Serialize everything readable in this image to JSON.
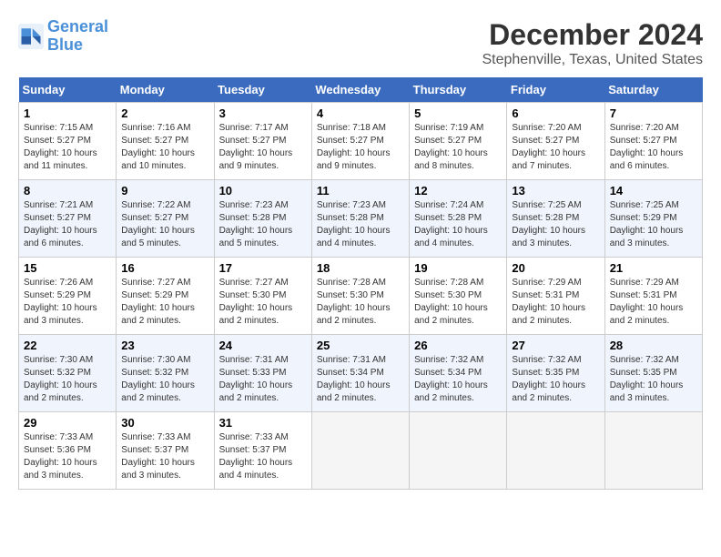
{
  "logo": {
    "line1": "General",
    "line2": "Blue"
  },
  "title": "December 2024",
  "subtitle": "Stephenville, Texas, United States",
  "days_of_week": [
    "Sunday",
    "Monday",
    "Tuesday",
    "Wednesday",
    "Thursday",
    "Friday",
    "Saturday"
  ],
  "weeks": [
    [
      {
        "day": "1",
        "info": "Sunrise: 7:15 AM\nSunset: 5:27 PM\nDaylight: 10 hours\nand 11 minutes."
      },
      {
        "day": "2",
        "info": "Sunrise: 7:16 AM\nSunset: 5:27 PM\nDaylight: 10 hours\nand 10 minutes."
      },
      {
        "day": "3",
        "info": "Sunrise: 7:17 AM\nSunset: 5:27 PM\nDaylight: 10 hours\nand 9 minutes."
      },
      {
        "day": "4",
        "info": "Sunrise: 7:18 AM\nSunset: 5:27 PM\nDaylight: 10 hours\nand 9 minutes."
      },
      {
        "day": "5",
        "info": "Sunrise: 7:19 AM\nSunset: 5:27 PM\nDaylight: 10 hours\nand 8 minutes."
      },
      {
        "day": "6",
        "info": "Sunrise: 7:20 AM\nSunset: 5:27 PM\nDaylight: 10 hours\nand 7 minutes."
      },
      {
        "day": "7",
        "info": "Sunrise: 7:20 AM\nSunset: 5:27 PM\nDaylight: 10 hours\nand 6 minutes."
      }
    ],
    [
      {
        "day": "8",
        "info": "Sunrise: 7:21 AM\nSunset: 5:27 PM\nDaylight: 10 hours\nand 6 minutes."
      },
      {
        "day": "9",
        "info": "Sunrise: 7:22 AM\nSunset: 5:27 PM\nDaylight: 10 hours\nand 5 minutes."
      },
      {
        "day": "10",
        "info": "Sunrise: 7:23 AM\nSunset: 5:28 PM\nDaylight: 10 hours\nand 5 minutes."
      },
      {
        "day": "11",
        "info": "Sunrise: 7:23 AM\nSunset: 5:28 PM\nDaylight: 10 hours\nand 4 minutes."
      },
      {
        "day": "12",
        "info": "Sunrise: 7:24 AM\nSunset: 5:28 PM\nDaylight: 10 hours\nand 4 minutes."
      },
      {
        "day": "13",
        "info": "Sunrise: 7:25 AM\nSunset: 5:28 PM\nDaylight: 10 hours\nand 3 minutes."
      },
      {
        "day": "14",
        "info": "Sunrise: 7:25 AM\nSunset: 5:29 PM\nDaylight: 10 hours\nand 3 minutes."
      }
    ],
    [
      {
        "day": "15",
        "info": "Sunrise: 7:26 AM\nSunset: 5:29 PM\nDaylight: 10 hours\nand 3 minutes."
      },
      {
        "day": "16",
        "info": "Sunrise: 7:27 AM\nSunset: 5:29 PM\nDaylight: 10 hours\nand 2 minutes."
      },
      {
        "day": "17",
        "info": "Sunrise: 7:27 AM\nSunset: 5:30 PM\nDaylight: 10 hours\nand 2 minutes."
      },
      {
        "day": "18",
        "info": "Sunrise: 7:28 AM\nSunset: 5:30 PM\nDaylight: 10 hours\nand 2 minutes."
      },
      {
        "day": "19",
        "info": "Sunrise: 7:28 AM\nSunset: 5:30 PM\nDaylight: 10 hours\nand 2 minutes."
      },
      {
        "day": "20",
        "info": "Sunrise: 7:29 AM\nSunset: 5:31 PM\nDaylight: 10 hours\nand 2 minutes."
      },
      {
        "day": "21",
        "info": "Sunrise: 7:29 AM\nSunset: 5:31 PM\nDaylight: 10 hours\nand 2 minutes."
      }
    ],
    [
      {
        "day": "22",
        "info": "Sunrise: 7:30 AM\nSunset: 5:32 PM\nDaylight: 10 hours\nand 2 minutes."
      },
      {
        "day": "23",
        "info": "Sunrise: 7:30 AM\nSunset: 5:32 PM\nDaylight: 10 hours\nand 2 minutes."
      },
      {
        "day": "24",
        "info": "Sunrise: 7:31 AM\nSunset: 5:33 PM\nDaylight: 10 hours\nand 2 minutes."
      },
      {
        "day": "25",
        "info": "Sunrise: 7:31 AM\nSunset: 5:34 PM\nDaylight: 10 hours\nand 2 minutes."
      },
      {
        "day": "26",
        "info": "Sunrise: 7:32 AM\nSunset: 5:34 PM\nDaylight: 10 hours\nand 2 minutes."
      },
      {
        "day": "27",
        "info": "Sunrise: 7:32 AM\nSunset: 5:35 PM\nDaylight: 10 hours\nand 2 minutes."
      },
      {
        "day": "28",
        "info": "Sunrise: 7:32 AM\nSunset: 5:35 PM\nDaylight: 10 hours\nand 3 minutes."
      }
    ],
    [
      {
        "day": "29",
        "info": "Sunrise: 7:33 AM\nSunset: 5:36 PM\nDaylight: 10 hours\nand 3 minutes."
      },
      {
        "day": "30",
        "info": "Sunrise: 7:33 AM\nSunset: 5:37 PM\nDaylight: 10 hours\nand 3 minutes."
      },
      {
        "day": "31",
        "info": "Sunrise: 7:33 AM\nSunset: 5:37 PM\nDaylight: 10 hours\nand 4 minutes."
      },
      null,
      null,
      null,
      null
    ]
  ]
}
